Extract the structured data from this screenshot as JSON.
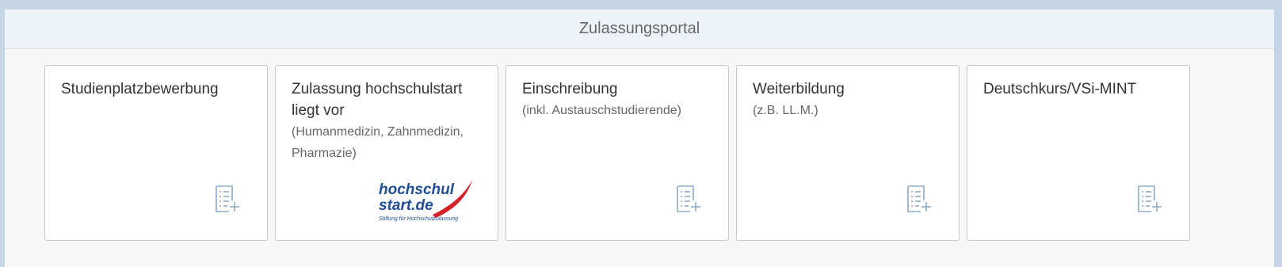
{
  "header": {
    "title": "Zulassungsportal"
  },
  "tiles": [
    {
      "title": "Studienplatzbewerbung",
      "subtitle": "",
      "icon": "form-add-icon"
    },
    {
      "title": "Zulassung hochschulstart liegt vor",
      "subtitle": "(Humanmedizin, Zahnmedizin, Pharmazie)",
      "logo": {
        "line1": "hochschul",
        "line2": "start.de",
        "tagline": "Stiftung für Hochschulzulassung"
      }
    },
    {
      "title": "Einschreibung",
      "subtitle": "(inkl. Austauschstudierende)",
      "icon": "form-add-icon"
    },
    {
      "title": "Weiterbildung",
      "subtitle": "(z.B. LL.M.)",
      "icon": "form-add-icon"
    },
    {
      "title": "Deutschkurs/VSi-MINT",
      "subtitle": "",
      "icon": "form-add-icon"
    }
  ],
  "colors": {
    "icon": "#8eaac4",
    "logo_blue": "#1f4e96",
    "logo_red": "#d4202a"
  }
}
